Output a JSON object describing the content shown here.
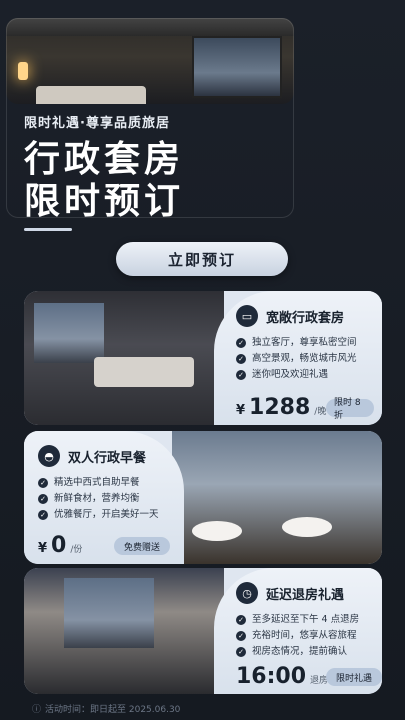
{
  "hero": {
    "eyebrow": "限时礼遇·尊享品质旅居",
    "title_line1": "行政套房",
    "title_line2": "限时预订"
  },
  "cta": {
    "label": "立即预订"
  },
  "cards": [
    {
      "title": "宽敞行政套房",
      "icon": "bed-icon",
      "bullets": [
        "独立客厅，尊享私密空间",
        "高空景观，畅览城市风光",
        "迷你吧及欢迎礼遇"
      ],
      "currency": "¥",
      "price": "1288",
      "unit": "/晚",
      "tag": "限时 8 折"
    },
    {
      "title": "双人行政早餐",
      "icon": "cloche-icon",
      "bullets": [
        "精选中西式自助早餐",
        "新鲜食材，营养均衡",
        "优雅餐厅，开启美好一天"
      ],
      "currency": "¥",
      "price": "0",
      "unit": "/份",
      "tag": "免费赠送"
    },
    {
      "title": "延迟退房礼遇",
      "icon": "clock-icon",
      "bullets": [
        "至多延迟至下午 4 点退房",
        "充裕时间，悠享从容旅程",
        "视房态情况，提前确认"
      ],
      "currency": "",
      "price": "16:00",
      "unit": "退房",
      "tag": "限时礼遇"
    }
  ],
  "footer": {
    "text": "活动时间：即日起至 2025.06.30"
  }
}
